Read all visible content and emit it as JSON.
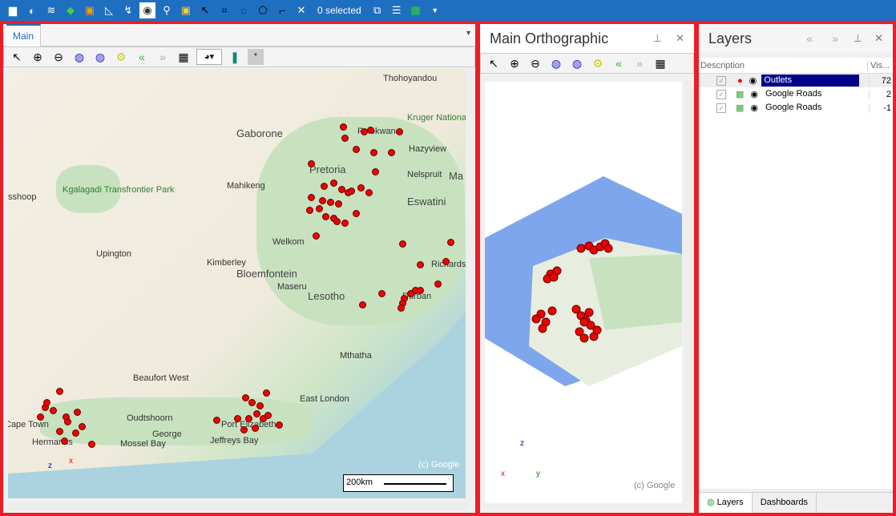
{
  "topbar": {
    "selected_label": "0 selected",
    "icons": [
      "folder-icon",
      "palette-icon",
      "layers-icon",
      "google-maps-icon",
      "b-icon",
      "measure-icon",
      "route-icon",
      "globe-icon",
      "pin-icon",
      "frame-icon",
      "select-point-icon",
      "select-rect-icon",
      "select-circle-icon",
      "select-polygon-icon",
      "select-line-icon",
      "clear-selection-icon",
      "export-icon",
      "table-icon",
      "excel-icon",
      "dropdown-icon"
    ]
  },
  "main": {
    "tab": "Main",
    "map_labels": [
      "Gaborone",
      "Polokwane",
      "Kruger National Park",
      "Hazyview",
      "Thohoyandou",
      "Pretoria",
      "Mahikeng",
      "Nelspruit",
      "Ma",
      "Eswatini",
      "Kgalagadi Transfrontier Park",
      "Upington",
      "Welkom",
      "Kimberley",
      "Bloemfontein",
      "Maseru",
      "Lesotho",
      "Durban",
      "Richards Bay",
      "Mthatha",
      "Beaufort West",
      "East London",
      "Oudtshoorn",
      "George",
      "Mossel Bay",
      "Port Elizabeth",
      "Jeffreys Bay",
      "Cape Town",
      "Hermanus",
      "sshoop"
    ],
    "attribution": "(c) Google",
    "scale": "200km",
    "axis_z": "z",
    "axis_x": "x"
  },
  "ortho": {
    "title": "Main Orthographic",
    "attribution": "(c) Google",
    "axis_z": "z",
    "axis_x": "x",
    "axis_y": "y"
  },
  "layers": {
    "title": "Layers",
    "columns": [
      "Description",
      "Vis..."
    ],
    "rows": [
      {
        "name": "Outlets",
        "vis": "72",
        "selected": true
      },
      {
        "name": "Google Roads",
        "vis": "2"
      },
      {
        "name": "Google Roads",
        "vis": "-1"
      }
    ],
    "bottom_tabs": [
      "Layers",
      "Dashboards"
    ]
  },
  "colors": {
    "accent": "#1f6fc0",
    "frame": "#ee1c25",
    "selection": "#000088",
    "points": "#ee0000"
  }
}
